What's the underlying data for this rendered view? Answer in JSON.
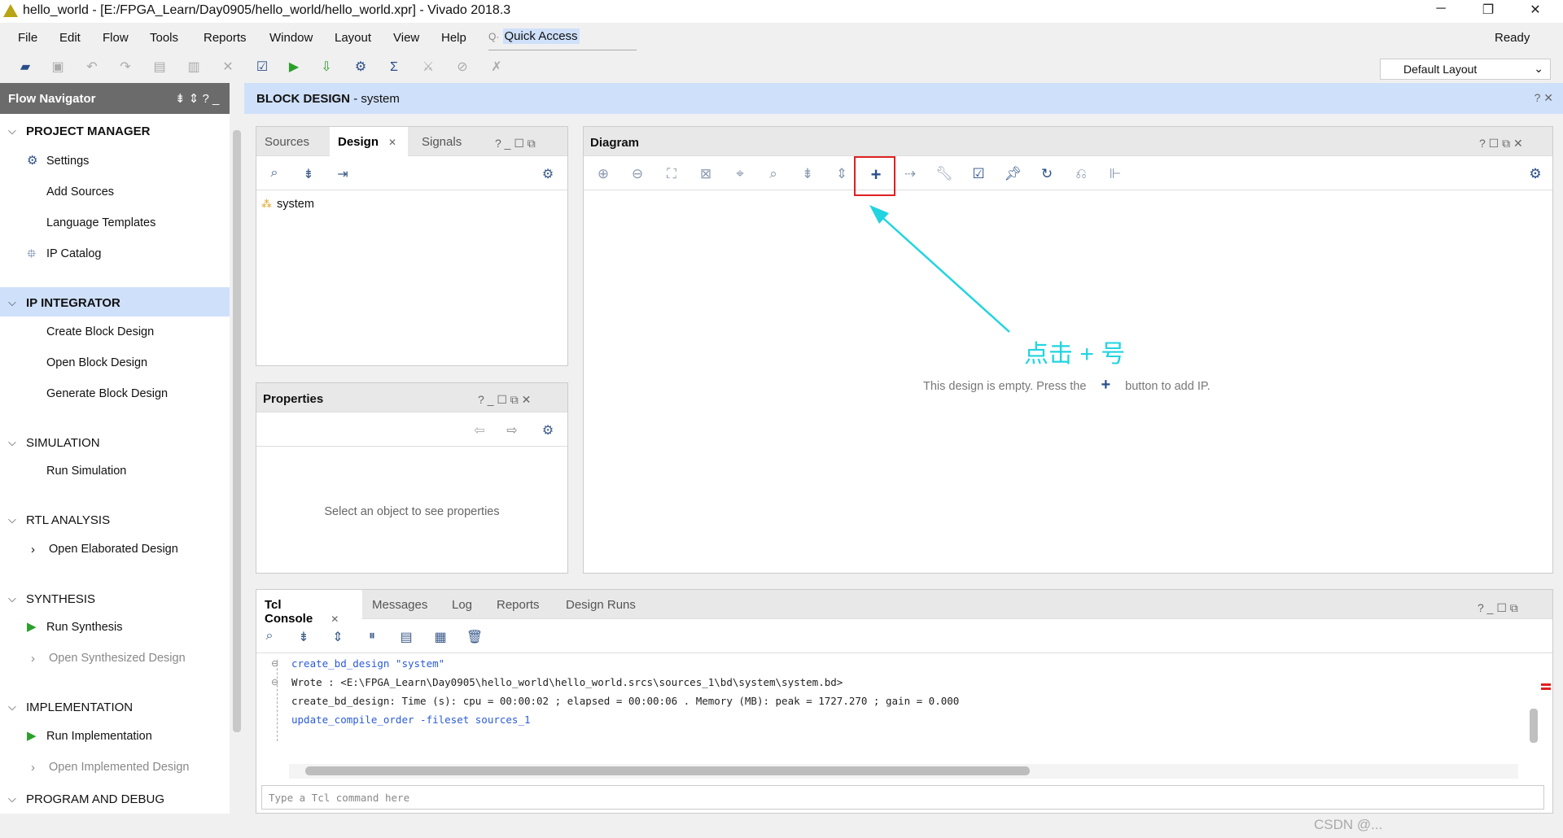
{
  "window": {
    "title": "hello_world - [E:/FPGA_Learn/Day0905/hello_world/hello_world.xpr] - Vivado 2018.3",
    "status": "Ready"
  },
  "menu": [
    "File",
    "Edit",
    "Flow",
    "Tools",
    "Reports",
    "Window",
    "Layout",
    "View",
    "Help"
  ],
  "quick_access": "Quick Access",
  "layout_select": "Default Layout",
  "flow_navigator": {
    "title": "Flow Navigator",
    "sections": [
      {
        "label": "PROJECT MANAGER",
        "items": [
          "Settings",
          "Add Sources",
          "Language Templates",
          "IP Catalog"
        ]
      },
      {
        "label": "IP INTEGRATOR",
        "items": [
          "Create Block Design",
          "Open Block Design",
          "Generate Block Design"
        ]
      },
      {
        "label": "SIMULATION",
        "items": [
          "Run Simulation"
        ]
      },
      {
        "label": "RTL ANALYSIS",
        "items": [
          "Open Elaborated Design"
        ]
      },
      {
        "label": "SYNTHESIS",
        "items": [
          "Run Synthesis",
          "Open Synthesized Design"
        ]
      },
      {
        "label": "IMPLEMENTATION",
        "items": [
          "Run Implementation",
          "Open Implemented Design"
        ]
      },
      {
        "label": "PROGRAM AND DEBUG",
        "items": []
      }
    ]
  },
  "block_design": {
    "title": "BLOCK DESIGN",
    "name": "- system"
  },
  "sources": {
    "tabs": [
      "Sources",
      "Design",
      "Signals"
    ],
    "tree": [
      "system"
    ]
  },
  "properties": {
    "title": "Properties",
    "empty": "Select an object to see properties"
  },
  "diagram": {
    "title": "Diagram",
    "annotation": "点击 + 号",
    "empty_pre": "This design is empty. Press the",
    "empty_post": "button to add IP.",
    "accent": "#22d4e0",
    "highlight": "#e02020"
  },
  "tcl": {
    "tabs": [
      "Tcl Console",
      "Messages",
      "Log",
      "Reports",
      "Design Runs"
    ],
    "lines": [
      {
        "text": "create_bd_design \"system\"",
        "color": "#2a5bd7"
      },
      {
        "text": "Wrote  : <E:\\FPGA_Learn\\Day0905\\hello_world\\hello_world.srcs\\sources_1\\bd\\system\\system.bd>",
        "color": "#222"
      },
      {
        "text": "create_bd_design: Time (s): cpu = 00:00:02 ; elapsed = 00:00:06 . Memory (MB): peak = 1727.270 ; gain = 0.000",
        "color": "#222"
      },
      {
        "text": "update_compile_order -fileset sources_1",
        "color": "#2a5bd7"
      }
    ],
    "placeholder": "Type a Tcl command here"
  },
  "watermark": "CSDN @..."
}
